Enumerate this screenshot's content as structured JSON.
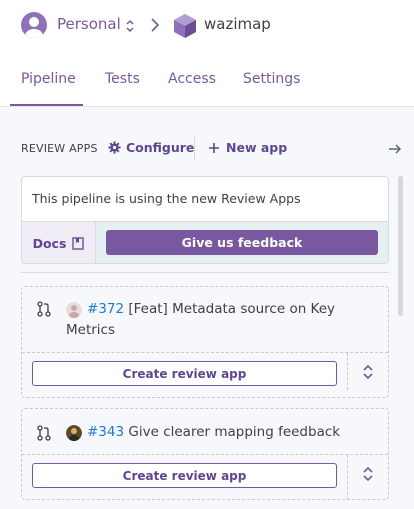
{
  "header": {
    "team_name": "Personal",
    "app_name": "wazimap"
  },
  "tabs": [
    {
      "label": "Pipeline",
      "active": true
    },
    {
      "label": "Tests",
      "active": false
    },
    {
      "label": "Access",
      "active": false
    },
    {
      "label": "Settings",
      "active": false
    }
  ],
  "review_apps": {
    "section_label": "REVIEW APPS",
    "configure_label": "Configure",
    "new_app_label": "New app",
    "info_text": "This pipeline is using the new Review Apps",
    "docs_label": "Docs",
    "feedback_label": "Give us feedback"
  },
  "pull_requests": [
    {
      "number": "#372",
      "title_line1": "[Feat] Metadata source on Key",
      "title_line2": "Metrics",
      "button_label": "Create review app"
    },
    {
      "number": "#343",
      "title_line1": "Give clearer mapping feedback",
      "button_label": "Create review app"
    }
  ],
  "colors": {
    "brand": "#79589f",
    "link": "#1e7bcb",
    "info_bar": "#e6eff2"
  },
  "icons": [
    "user-avatar-icon",
    "updown-icon",
    "chevron-right-icon",
    "app-hexagon-icon",
    "gear-icon",
    "plus-icon",
    "arrow-right-icon",
    "book-icon",
    "pull-request-icon",
    "double-chevron-icon"
  ]
}
